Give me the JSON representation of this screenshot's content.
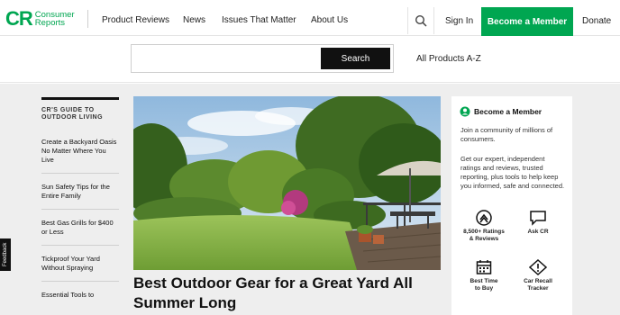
{
  "header": {
    "logo_mark": "CR",
    "logo_line1": "Consumer",
    "logo_line2": "Reports",
    "nav": [
      "Product Reviews",
      "News",
      "Issues That Matter",
      "About Us"
    ],
    "signin": "Sign In",
    "member_button": "Become a Member",
    "donate": "Donate"
  },
  "search": {
    "placeholder": "",
    "button": "Search",
    "all_products": "All Products A-Z"
  },
  "guide": {
    "title_line1": "CR'S GUIDE TO",
    "title_line2": "OUTDOOR LIVING",
    "items": [
      "Create a Backyard Oasis No Matter Where You Live",
      "Sun Safety Tips for the Entire Family",
      "Best Gas Grills for $400 or Less",
      "Tickproof Your Yard Without Spraying",
      "Essential Tools to"
    ]
  },
  "feedback": "Feedback",
  "hero": {
    "headline": "Best Outdoor Gear for a Great Yard All Summer Long"
  },
  "card": {
    "title": "Become a Member",
    "intro": "Join a community of millions of consumers.",
    "body": "Get our expert, independent ratings and reviews, trusted reporting, plus tools to help keep you informed, safe and connected.",
    "features": [
      {
        "line1": "8,500+ Ratings",
        "line2": "& Reviews",
        "icon": "ratings-icon"
      },
      {
        "line1": "Ask CR",
        "line2": "",
        "icon": "chat-icon"
      },
      {
        "line1": "Best Time",
        "line2": "to Buy",
        "icon": "calendar-icon"
      },
      {
        "line1": "Car Recall",
        "line2": "Tracker",
        "icon": "warning-icon"
      }
    ]
  },
  "colors": {
    "brand": "#00a651",
    "dark": "#111111",
    "background": "#eeeeee"
  }
}
